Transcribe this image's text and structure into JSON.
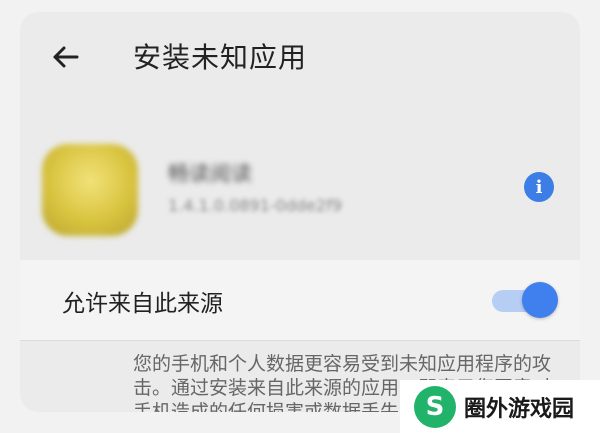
{
  "header": {
    "back_icon": "arrow-left-icon",
    "title": "安装未知应用"
  },
  "app": {
    "name": "畅读阅读",
    "version": "1.4.1.0.0891-0dde2f9",
    "info_icon": "info-icon",
    "info_symbol": "i"
  },
  "permission": {
    "label": "允许来自此来源",
    "enabled": true,
    "accent_color": "#4080ee"
  },
  "warning": {
    "text": "您的手机和个人数据更容易受到未知应用程序的攻击。通过安装来自此来源的应用，即表示您同意对手机造成的任何损害或数据丢失负责。"
  },
  "watermark": {
    "logo_glyph": "S",
    "text": "圈外游戏园"
  }
}
